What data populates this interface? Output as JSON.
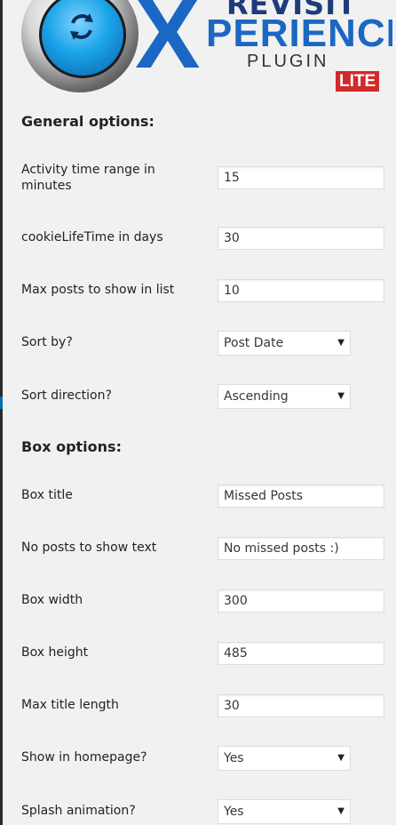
{
  "logo": {
    "revisit": "REVISIT",
    "x_letter": "X",
    "perience": "PERIENCE",
    "plugin": "PLUGIN",
    "lite": "LITE"
  },
  "general": {
    "title": "General options:",
    "activity_label": "Activity time range in minutes",
    "activity_value": "15",
    "cookie_label": "cookieLifeTime in days",
    "cookie_value": "30",
    "max_posts_label": "Max posts to show in list",
    "max_posts_value": "10",
    "sort_by_label": "Sort by?",
    "sort_by_value": "Post Date",
    "sort_dir_label": "Sort direction?",
    "sort_dir_value": "Ascending"
  },
  "box": {
    "title": "Box options:",
    "box_title_label": "Box title",
    "box_title_value": "Missed Posts",
    "no_posts_label": "No posts to show text",
    "no_posts_value": "No missed posts :)",
    "width_label": "Box width",
    "width_value": "300",
    "height_label": "Box height",
    "height_value": "485",
    "max_title_label": "Max title length",
    "max_title_value": "30",
    "homepage_label": "Show in homepage?",
    "homepage_value": "Yes",
    "splash_label": "Splash animation?",
    "splash_value": "Yes"
  },
  "icons": {
    "logo": "revisit-arrows-icon",
    "dropdown": "chevron-down-icon"
  },
  "colors": {
    "brand_blue": "#1b67c4",
    "lite_red": "#d02a2a",
    "page_bg": "#f1f1f1"
  }
}
